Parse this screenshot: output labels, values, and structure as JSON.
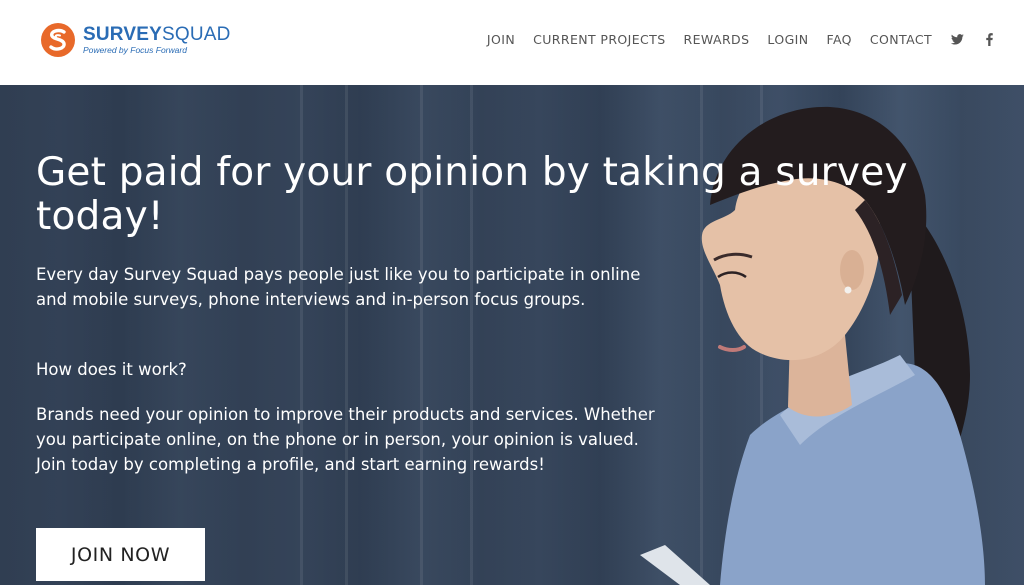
{
  "header": {
    "logo": {
      "name_bold": "SURVEY",
      "name_regular": "SQUAD",
      "tagline": "Powered by Focus Forward"
    },
    "nav": {
      "join": "JOIN",
      "current_projects": "CURRENT PROJECTS",
      "rewards": "REWARDS",
      "login": "LOGIN",
      "faq": "FAQ",
      "contact": "CONTACT"
    },
    "social": [
      "twitter-icon",
      "facebook-icon"
    ]
  },
  "hero": {
    "headline": "Get paid for your opinion by taking a survey today!",
    "paragraph_1": "Every day Survey Squad pays people just like you to participate in online and mobile surveys, phone interviews and in-person focus groups.",
    "paragraph_2": "How does it work?",
    "paragraph_3": "Brands need your opinion to improve their products and services. Whether you participate online, on the phone or in person, your opinion is valued.  Join today by completing a profile, and start earning rewards!",
    "cta_label": "JOIN NOW"
  },
  "colors": {
    "brand_orange": "#e8692a",
    "brand_blue": "#2a6cb5",
    "nav_text": "#555555",
    "hero_overlay": "#3d4d64",
    "button_bg": "#ffffff"
  }
}
